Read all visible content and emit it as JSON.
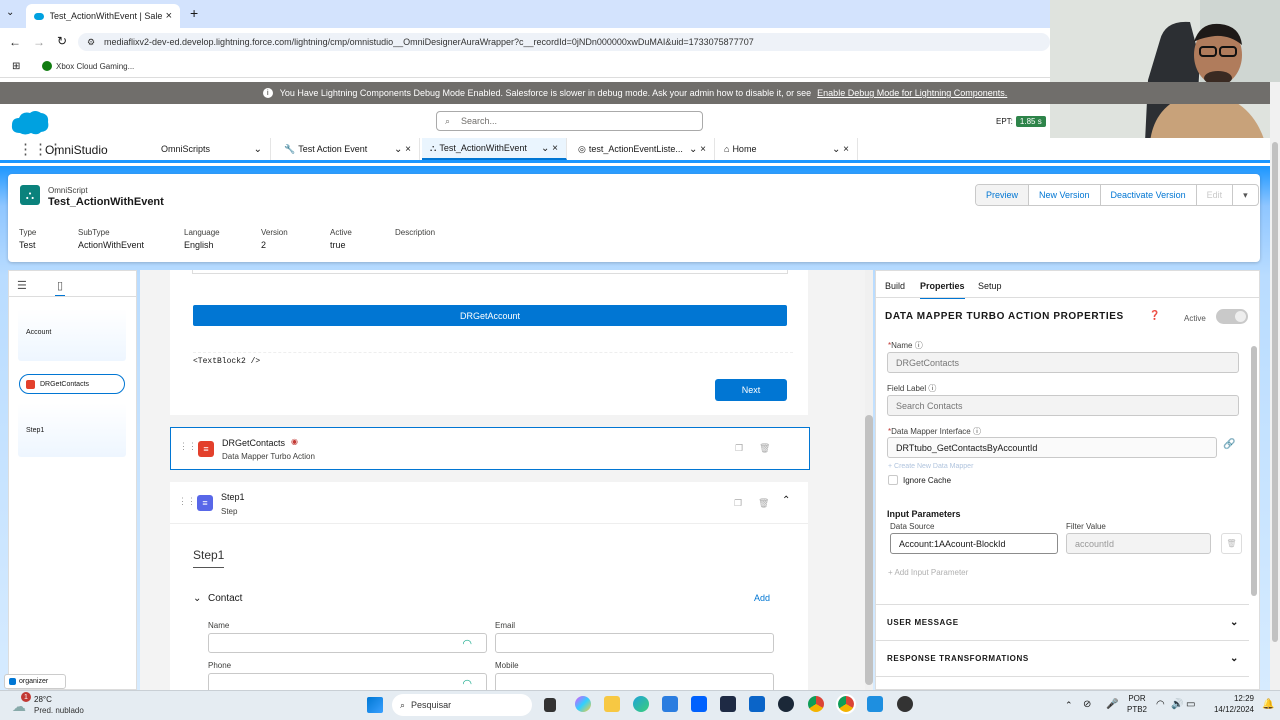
{
  "browser": {
    "tab_title": "Test_ActionWithEvent | Salesforc",
    "url": "mediaflixv2-dev-ed.develop.lightning.force.com/lightning/cmp/omnistudio__OmniDesignerAuraWrapper?c__recordId=0jNDn000000xwDuMAI&uid=1733075877707",
    "bookmark": "Xbox Cloud Gaming..."
  },
  "debug_banner": {
    "text": "You Have Lightning Components Debug Mode Enabled. Salesforce is slower in debug mode. Ask your admin how to disable it, or see",
    "link": "Enable Debug Mode for Lightning Components."
  },
  "header": {
    "search_placeholder": "Search...",
    "ept_label": "EPT:",
    "ept_value": "1.85 s"
  },
  "nav": {
    "app_name": "OmniStudio",
    "tabs": [
      {
        "label": "OmniScripts"
      },
      {
        "label": "Test Action Event"
      },
      {
        "label": "Test_ActionWithEvent"
      },
      {
        "label": "test_ActionEventListe..."
      },
      {
        "label": "Home"
      }
    ]
  },
  "omniscript": {
    "kind": "OmniScript",
    "name": "Test_ActionWithEvent",
    "buttons": [
      "Preview",
      "New Version",
      "Deactivate Version",
      "Edit"
    ],
    "fields": [
      {
        "label": "Type",
        "value": "Test"
      },
      {
        "label": "SubType",
        "value": "ActionWithEvent"
      },
      {
        "label": "Language",
        "value": "English"
      },
      {
        "label": "Version",
        "value": "2"
      },
      {
        "label": "Active",
        "value": "true"
      },
      {
        "label": "Description",
        "value": ""
      }
    ]
  },
  "left_panel": {
    "items": [
      {
        "label": "Account"
      },
      {
        "label": "DRGetContacts"
      },
      {
        "label": "Step1"
      }
    ]
  },
  "canvas": {
    "dr_button": "DRGetAccount",
    "textblock": "<TextBlock2 />",
    "next_button": "Next",
    "element1": {
      "title": "DRGetContacts",
      "subtitle": "Data Mapper Turbo Action"
    },
    "element2": {
      "title": "Step1",
      "subtitle": "Step"
    },
    "step_heading": "Step1",
    "block_title": "Contact",
    "add_label": "Add",
    "fields": {
      "name": "Name",
      "email": "Email",
      "phone": "Phone",
      "mobile": "Mobile"
    }
  },
  "properties": {
    "tabs": [
      "Build",
      "Properties",
      "Setup"
    ],
    "title": "DATA MAPPER TURBO ACTION PROPERTIES",
    "active_label": "Active",
    "name_label": "Name",
    "name_value": "DRGetContacts",
    "field_label_label": "Field Label",
    "field_label_value": "Search Contacts",
    "dm_interface_label": "Data Mapper Interface",
    "dm_interface_value": "DRTtubo_GetContactsByAccountId",
    "create_new": "+ Create New Data Mapper",
    "ignore_cache": "Ignore Cache",
    "input_params": "Input Parameters",
    "data_source_label": "Data Source",
    "data_source_value": "Account:1AAcount-BlockId",
    "filter_value_label": "Filter Value",
    "filter_value_value": "accountId",
    "add_input": "Add Input Parameter",
    "sections": [
      "USER MESSAGE",
      "RESPONSE TRANSFORMATIONS"
    ]
  },
  "taskbar": {
    "weather_temp": "28°C",
    "weather_desc": "Pred. nublado",
    "search": "Pesquisar",
    "lang": "POR",
    "layout": "PTB2",
    "time": "12:29",
    "date": "14/12/2024",
    "organizer": "organizer",
    "notif_count": "1"
  },
  "colors": {
    "brand": "#0176d3",
    "banner": "#706e6b",
    "accent": "#1b96ff"
  }
}
